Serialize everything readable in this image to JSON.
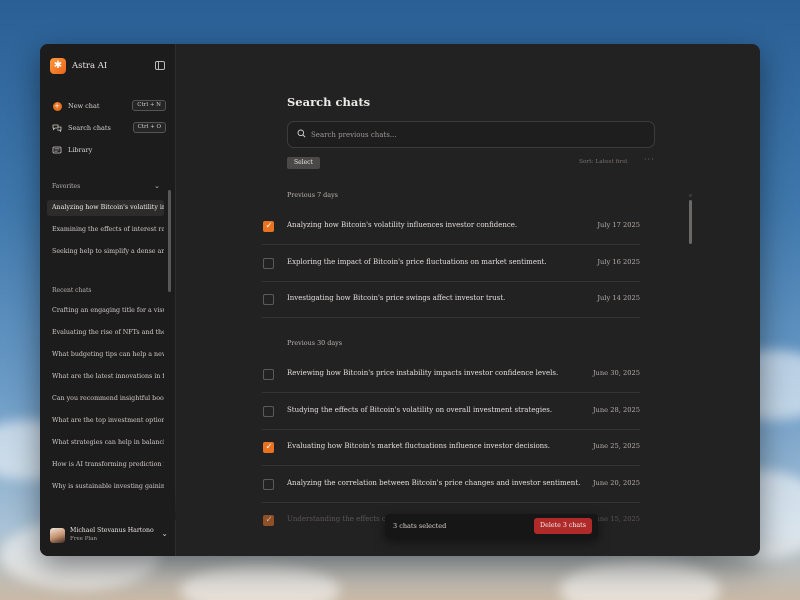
{
  "app": {
    "name": "Astra AI"
  },
  "nav": [
    {
      "label": "New chat",
      "icon": "plus-circle-icon",
      "shortcut": "Ctrl + N"
    },
    {
      "label": "Search chats",
      "icon": "chat-bubbles-icon",
      "shortcut": "Ctrl + O"
    },
    {
      "label": "Library",
      "icon": "library-icon"
    }
  ],
  "sidebar": {
    "favorites_label": "Favorites",
    "favorites": [
      "Analyzing how Bitcoin's volatility influences investor confidence.",
      "Examining the effects of interest rates on markets.",
      "Seeking help to simplify a dense analysis."
    ],
    "recent_label": "Recent chats",
    "recent": [
      "Crafting an engaging title for a visual story.",
      "Evaluating the rise of NFTs and their value.",
      "What budgeting tips can help a new investor?",
      "What are the latest innovations in fintech?",
      "Can you recommend insightful books on finance?",
      "What are the top investment options today?",
      "What strategies can help in balancing a portfolio?",
      "How is AI transforming prediction markets?",
      "Why is sustainable investing gaining traction?"
    ]
  },
  "user": {
    "name": "Michael Stevanus Hartono",
    "plan": "Free Plan"
  },
  "main": {
    "title": "Search chats",
    "search_placeholder": "Search previous chats...",
    "select_label": "Select",
    "sort_label": "Sort: Latest first",
    "more_label": "···",
    "groups": [
      {
        "label": "Previous 7 days",
        "rows": [
          {
            "title": "Analyzing how Bitcoin's volatility influences investor confidence.",
            "date": "July 17 2025",
            "checked": true
          },
          {
            "title": "Exploring the impact of Bitcoin's price fluctuations on market sentiment.",
            "date": "July 16 2025",
            "checked": false
          },
          {
            "title": "Investigating how Bitcoin's price swings affect investor trust.",
            "date": "July 14 2025",
            "checked": false
          }
        ]
      },
      {
        "label": "Previous 30 days",
        "rows": [
          {
            "title": "Reviewing how Bitcoin's price instability impacts investor confidence levels.",
            "date": "June 30, 2025",
            "checked": false
          },
          {
            "title": "Studying the effects of Bitcoin's volatility on overall investment strategies.",
            "date": "June 28, 2025",
            "checked": false
          },
          {
            "title": "Evaluating how Bitcoin's market fluctuations influence investor decisions.",
            "date": "June 25, 2025",
            "checked": true
          },
          {
            "title": "Analyzing the correlation between Bitcoin's price changes and investor sentiment.",
            "date": "June 20, 2025",
            "checked": false
          },
          {
            "title": "Understanding the effects of Bitcoin's volatility on investor behavior.",
            "date": "June 15, 2025",
            "checked": true
          }
        ]
      }
    ],
    "selection": {
      "count_label": "3 chats selected",
      "delete_label": "Delete 3 chats"
    }
  },
  "colors": {
    "accent": "#e8721f",
    "danger": "#b02a2a",
    "panel": "#232222",
    "sidebar": "#1d1c1c"
  }
}
